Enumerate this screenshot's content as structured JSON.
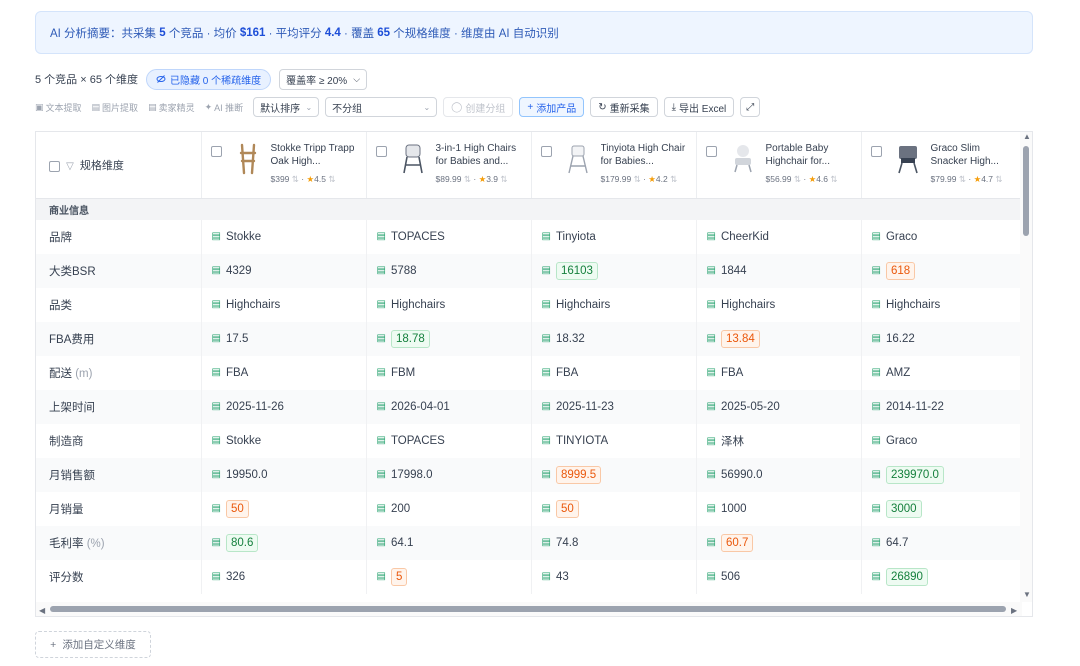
{
  "summary": {
    "prefix": "AI 分析摘要：共采集",
    "count": "5",
    "t1": "个竞品 · 均价",
    "avg_price": "$161",
    "t2": "· 平均评分",
    "avg_rating": "4.4",
    "t3": "· 覆盖",
    "dims": "65",
    "t4": "个规格维度 · 维度由 AI 自动识别"
  },
  "toolbar1": {
    "count_text": "5 个竞品 × 65 个维度",
    "hidden_pill": "已隐藏 0 个稀疏维度",
    "coverage": "覆盖率 ≥ 20%"
  },
  "toolbar2": {
    "extract_text": "文本提取",
    "extract_image": "图片提取",
    "seller_sprite": "卖家精灵",
    "ai_infer": "AI 推断",
    "sort": "默认排序",
    "group": "不分组",
    "create_group": "创建分组",
    "add_product": "添加产品",
    "recollect": "重新采集",
    "export": "导出 Excel"
  },
  "table": {
    "dim_header": "规格维度",
    "section": "商业信息",
    "products": [
      {
        "name": "Stokke Tripp Trapp Oak High...",
        "price": "$399",
        "rating": "4.5"
      },
      {
        "name": "3-in-1 High Chairs for Babies and...",
        "price": "$89.99",
        "rating": "3.9"
      },
      {
        "name": "Tinyiota High Chair for Babies...",
        "price": "$179.99",
        "rating": "4.2"
      },
      {
        "name": "Portable Baby Highchair for...",
        "price": "$56.99",
        "rating": "4.6"
      },
      {
        "name": "Graco Slim Snacker High...",
        "price": "$79.99",
        "rating": "4.7"
      }
    ],
    "rows": [
      {
        "label": "品牌",
        "unit": "",
        "cells": [
          {
            "v": "Stokke",
            "t": ""
          },
          {
            "v": "TOPACES",
            "t": ""
          },
          {
            "v": "Tinyiota",
            "t": ""
          },
          {
            "v": "CheerKid",
            "t": ""
          },
          {
            "v": "Graco",
            "t": ""
          }
        ]
      },
      {
        "label": "大类BSR",
        "unit": "",
        "cells": [
          {
            "v": "4329",
            "t": ""
          },
          {
            "v": "5788",
            "t": ""
          },
          {
            "v": "16103",
            "t": "green"
          },
          {
            "v": "1844",
            "t": ""
          },
          {
            "v": "618",
            "t": "orange"
          }
        ]
      },
      {
        "label": "品类",
        "unit": "",
        "cells": [
          {
            "v": "Highchairs",
            "t": ""
          },
          {
            "v": "Highchairs",
            "t": ""
          },
          {
            "v": "Highchairs",
            "t": ""
          },
          {
            "v": "Highchairs",
            "t": ""
          },
          {
            "v": "Highchairs",
            "t": ""
          }
        ]
      },
      {
        "label": "FBA费用",
        "unit": "",
        "cells": [
          {
            "v": "17.5",
            "t": ""
          },
          {
            "v": "18.78",
            "t": "green"
          },
          {
            "v": "18.32",
            "t": ""
          },
          {
            "v": "13.84",
            "t": "orange"
          },
          {
            "v": "16.22",
            "t": ""
          }
        ]
      },
      {
        "label": "配送",
        "unit": "(m)",
        "cells": [
          {
            "v": "FBA",
            "t": ""
          },
          {
            "v": "FBM",
            "t": ""
          },
          {
            "v": "FBA",
            "t": ""
          },
          {
            "v": "FBA",
            "t": ""
          },
          {
            "v": "AMZ",
            "t": ""
          }
        ]
      },
      {
        "label": "上架时间",
        "unit": "",
        "cells": [
          {
            "v": "2025-11-26",
            "t": ""
          },
          {
            "v": "2026-04-01",
            "t": ""
          },
          {
            "v": "2025-11-23",
            "t": ""
          },
          {
            "v": "2025-05-20",
            "t": ""
          },
          {
            "v": "2014-11-22",
            "t": ""
          }
        ]
      },
      {
        "label": "制造商",
        "unit": "",
        "cells": [
          {
            "v": "Stokke",
            "t": ""
          },
          {
            "v": "TOPACES",
            "t": ""
          },
          {
            "v": "TINYIOTA",
            "t": ""
          },
          {
            "v": "泽林",
            "t": ""
          },
          {
            "v": "Graco",
            "t": ""
          }
        ]
      },
      {
        "label": "月销售额",
        "unit": "",
        "cells": [
          {
            "v": "19950.0",
            "t": ""
          },
          {
            "v": "17998.0",
            "t": ""
          },
          {
            "v": "8999.5",
            "t": "orange"
          },
          {
            "v": "56990.0",
            "t": ""
          },
          {
            "v": "239970.0",
            "t": "green"
          }
        ]
      },
      {
        "label": "月销量",
        "unit": "",
        "cells": [
          {
            "v": "50",
            "t": "orange"
          },
          {
            "v": "200",
            "t": ""
          },
          {
            "v": "50",
            "t": "orange"
          },
          {
            "v": "1000",
            "t": ""
          },
          {
            "v": "3000",
            "t": "green"
          }
        ]
      },
      {
        "label": "毛利率",
        "unit": "(%)",
        "cells": [
          {
            "v": "80.6",
            "t": "green"
          },
          {
            "v": "64.1",
            "t": ""
          },
          {
            "v": "74.8",
            "t": ""
          },
          {
            "v": "60.7",
            "t": "orange"
          },
          {
            "v": "64.7",
            "t": ""
          }
        ]
      },
      {
        "label": "评分数",
        "unit": "",
        "cells": [
          {
            "v": "326",
            "t": ""
          },
          {
            "v": "5",
            "t": "orange"
          },
          {
            "v": "43",
            "t": ""
          },
          {
            "v": "506",
            "t": ""
          },
          {
            "v": "26890",
            "t": "green"
          }
        ]
      }
    ]
  },
  "add_custom": "添加自定义维度"
}
